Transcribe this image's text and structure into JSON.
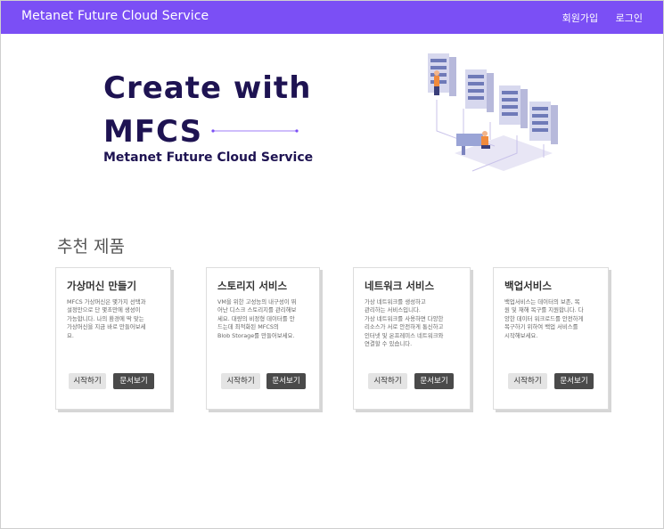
{
  "navbar": {
    "brand": "Metanet Future Cloud Service",
    "signup": "회원가입",
    "login": "로그인"
  },
  "hero": {
    "line1": "Create with",
    "line2": "MFCS",
    "subtitle": "Metanet Future Cloud Service"
  },
  "section": {
    "title": "추천 제품"
  },
  "cards": [
    {
      "title": "가상머신 만들기",
      "desc": "MFCS 가상머신은 몇가지 선택과\n설정만으로 단 몇초만에 생성이\n가능합니다. 나의 환경에 딱 맞는\n가상머신을 지금 바로 만들어보세\n요.",
      "start": "시작하기",
      "docs": "문서보기"
    },
    {
      "title": "스토리지 서비스",
      "desc": "VM을 위한 고성능의 내구성이 뛰\n어난 디스크 스토리지를 관리해보\n세요. 대량의 비정형 데이터를 안\n드는데 최적화된 MFCS의\nBlob Storage를 만들어보세요.",
      "start": "시작하기",
      "docs": "문서보기"
    },
    {
      "title": "네트워크 서비스",
      "desc": "가상 네트워크를 생성하고\n관리하는 서비스입니다.\n가상 네트워크를 사용하면 다양한\n리소스가 서로 안전하게 통신하고\n인터넷 및 온프레미스 네트워크와\n연결할 수 있습니다.",
      "start": "시작하기",
      "docs": "문서보기"
    },
    {
      "title": "백업서비스",
      "desc": "백업서비스는 데이터의 보존, 복\n원 및 재해 복구를 지원합니다. 다\n양한 데이터 워크로드를 안전하게\n복구하기 위하여 백업 서비스를\n시작해보세요.",
      "start": "시작하기",
      "docs": "문서보기"
    }
  ],
  "colors": {
    "navbar": "#7b4ff5",
    "hero_text": "#1e1352",
    "docs_button": "#4a4a4a"
  },
  "icons": {
    "illustration": "cloud-server-illustration"
  }
}
